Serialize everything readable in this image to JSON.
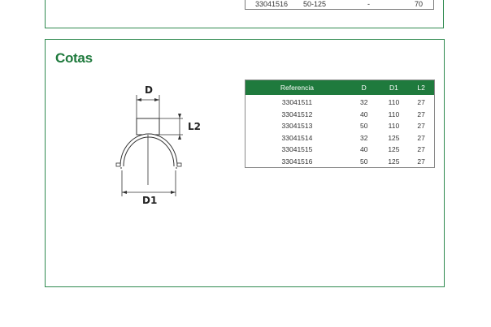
{
  "top_table": {
    "row": {
      "ref": "33041516",
      "range": "50-125",
      "dash": "-",
      "value": "70"
    }
  },
  "cotas": {
    "title": "Cotas",
    "diagram_labels": {
      "d": "D",
      "l2": "L2",
      "d1": "D1"
    },
    "table": {
      "headers": [
        "Referencia",
        "D",
        "D1",
        "L2"
      ],
      "rows": [
        [
          "33041511",
          "32",
          "110",
          "27"
        ],
        [
          "33041512",
          "40",
          "110",
          "27"
        ],
        [
          "33041513",
          "50",
          "110",
          "27"
        ],
        [
          "33041514",
          "32",
          "125",
          "27"
        ],
        [
          "33041515",
          "40",
          "125",
          "27"
        ],
        [
          "33041516",
          "50",
          "125",
          "27"
        ]
      ]
    }
  },
  "colors": {
    "brand_green": "#1f7a3d",
    "border_green": "#2f8a4f"
  }
}
